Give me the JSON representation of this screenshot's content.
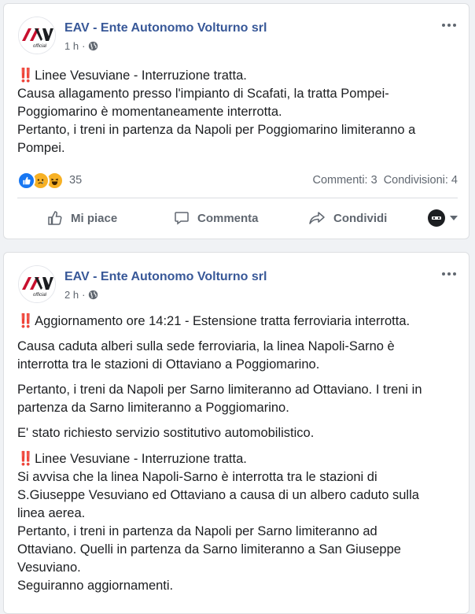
{
  "colors": {
    "page_name": "#385898",
    "text": "#1c1e21",
    "muted": "#606770",
    "warning": "#e3242b",
    "like_blue": "#1877f2",
    "emoji_yellow": "#f7b125"
  },
  "posts": [
    {
      "page_name": "EAV - Ente Autonomo Volturno srl",
      "logo_text": "official",
      "time": "1 h",
      "audience_icon": "globe-icon",
      "paragraphs": [
        {
          "lines": [
            {
              "emoji": "‼️",
              "text": "Linee Vesuviane - Interruzione tratta."
            },
            {
              "text": "Causa allagamento presso l'impianto di Scafati, la tratta Pompei-"
            },
            {
              "text": "Poggiomarino è momentaneamente interrotta."
            },
            {
              "text": "Pertanto, i treni in partenza da Napoli per Poggiomarino limiteranno a"
            },
            {
              "text": "Pompei."
            }
          ]
        }
      ],
      "reactions": [
        "like-icon",
        "sad-icon",
        "haha-icon"
      ],
      "reaction_count": "35",
      "comments": "Commenti: 3",
      "shares": "Condivisioni: 4",
      "actions": {
        "like": "Mi piace",
        "comment": "Commenta",
        "share": "Condividi"
      }
    },
    {
      "page_name": "EAV - Ente Autonomo Volturno srl",
      "logo_text": "official",
      "time": "2 h",
      "audience_icon": "globe-icon",
      "paragraphs": [
        {
          "lines": [
            {
              "emoji": "‼️",
              "text": "Aggiornamento ore 14:21 - Estensione tratta ferroviaria interrotta."
            }
          ]
        },
        {
          "lines": [
            {
              "text": "Causa caduta alberi sulla sede ferroviaria, la linea Napoli-Sarno è"
            },
            {
              "text": "interrotta tra le stazioni di Ottaviano a Poggiomarino."
            }
          ]
        },
        {
          "lines": [
            {
              "text": "Pertanto, i treni da Napoli per Sarno limiteranno ad Ottaviano. I treni in"
            },
            {
              "text": "partenza da Sarno limiteranno a Poggiomarino."
            }
          ]
        },
        {
          "lines": [
            {
              "text": "E' stato richiesto servizio sostitutivo automobilistico."
            }
          ]
        },
        {
          "lines": [
            {
              "emoji": "‼️",
              "text": "Linee Vesuviane - Interruzione tratta."
            },
            {
              "text": "Si avvisa che la linea Napoli-Sarno è interrotta tra le stazioni di"
            },
            {
              "text": "S.Giuseppe Vesuviano ed Ottaviano a causa di un albero caduto sulla"
            },
            {
              "text": "linea aerea."
            },
            {
              "text": "Pertanto, i treni in partenza da Napoli per Sarno limiteranno ad"
            },
            {
              "text": "Ottaviano. Quelli in partenza da Sarno limiteranno a San Giuseppe"
            },
            {
              "text": "Vesuviano."
            },
            {
              "text": "Seguiranno aggiornamenti."
            }
          ]
        }
      ]
    }
  ]
}
